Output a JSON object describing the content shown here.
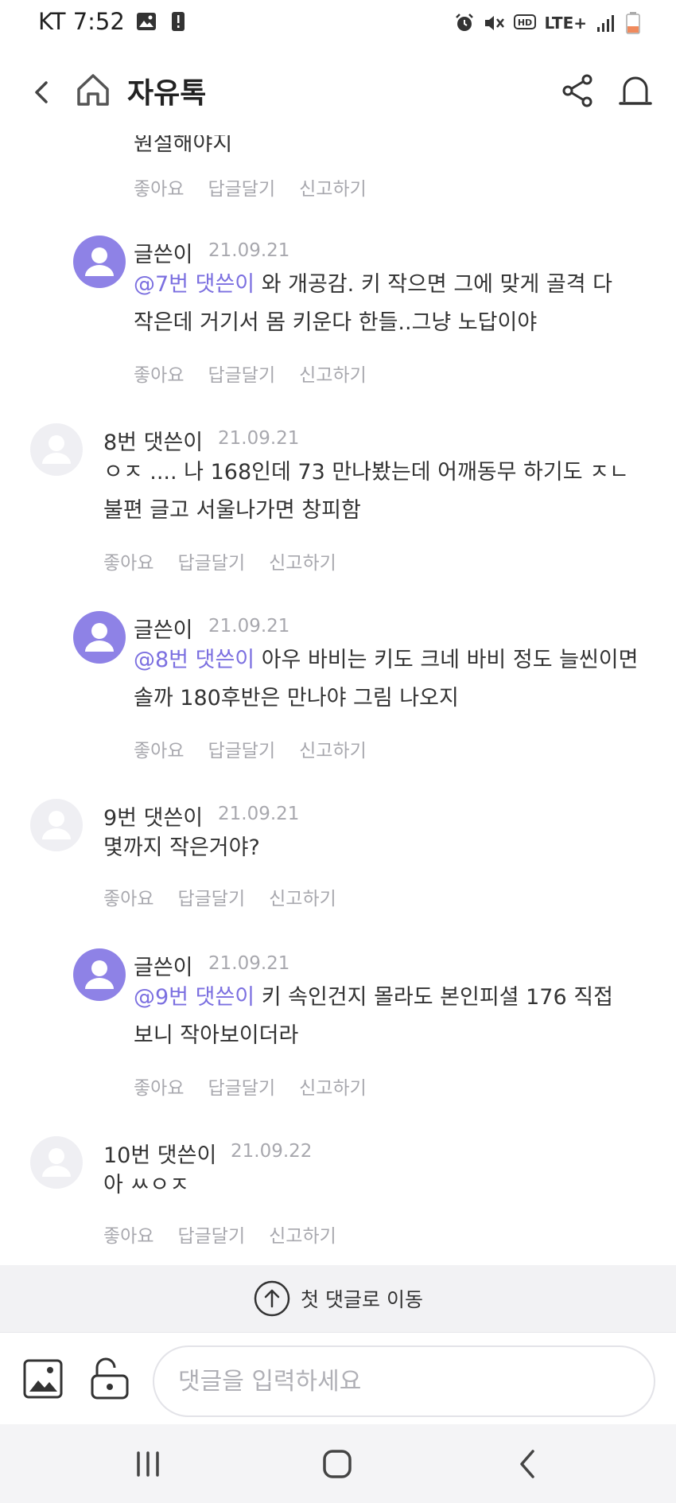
{
  "status_bar": {
    "carrier_time": "KT 7:52",
    "network": "LTE+"
  },
  "header": {
    "title": "자유톡"
  },
  "partial_comment": {
    "text": "원설해야지"
  },
  "actions": {
    "like": "좋아요",
    "reply": "답글달기",
    "report": "신고하기"
  },
  "comments": [
    {
      "name": "글쓴이",
      "date": "21.09.21",
      "mention": "@7번 댓쓴이",
      "line1": " 와 개공감. 키 작으면 그에 맞게 골격 다",
      "line2": "작은데 거기서 몸 키운다 한들..그냥 노답이야"
    },
    {
      "name": "8번 댓쓴이",
      "date": "21.09.21",
      "mention": "",
      "line1": "ㅇㅈ .... 나 168인데 73 만나봤는데 어깨동무 하기도 ㅈㄴ",
      "line2": "불편 글고 서울나가면 창피함"
    },
    {
      "name": "글쓴이",
      "date": "21.09.21",
      "mention": "@8번 댓쓴이",
      "line1": " 아우 바비는 키도 크네 바비 정도 늘씬이면",
      "line2": "솔까 180후반은 만나야 그림 나오지"
    },
    {
      "name": "9번 댓쓴이",
      "date": "21.09.21",
      "mention": "",
      "line1": "몇까지 작은거야?",
      "line2": ""
    },
    {
      "name": "글쓴이",
      "date": "21.09.21",
      "mention": "@9번 댓쓴이",
      "line1": " 키 속인건지 몰라도 본인피셜 176 직접",
      "line2": "보니 작아보이더라"
    },
    {
      "name": "10번 댓쓴이",
      "date": "21.09.22",
      "mention": "",
      "line1": "아 ㅆㅇㅈ",
      "line2": ""
    }
  ],
  "jump_bar": {
    "label": "첫 댓글로 이동"
  },
  "input_bar": {
    "placeholder": "댓글을 입력하세요"
  }
}
